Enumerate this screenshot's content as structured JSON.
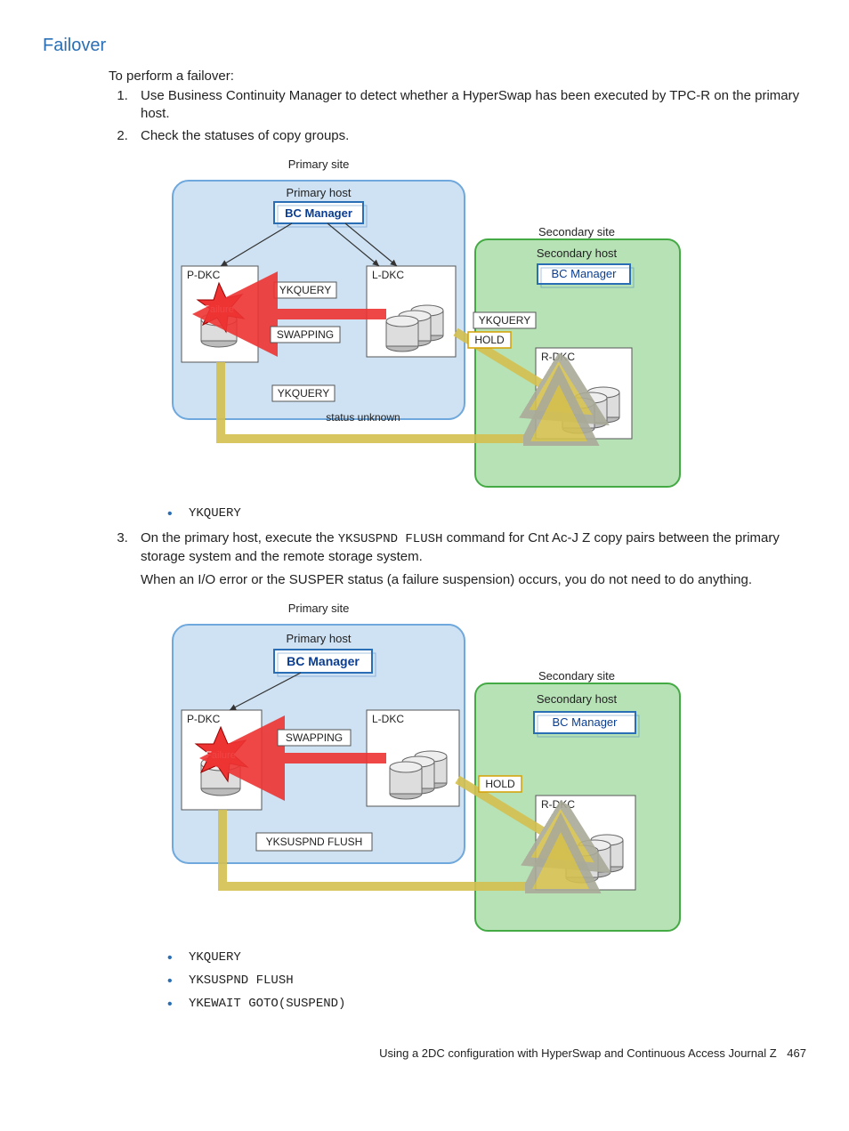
{
  "heading": "Failover",
  "intro": "To perform a failover:",
  "steps": {
    "s1": "Use Business Continuity Manager to detect whether a HyperSwap has been executed by TPC-R on the primary host.",
    "s2": "Check the statuses of copy groups.",
    "s3_a": "On the primary host, execute the ",
    "s3_code": "YKSUSPND FLUSH",
    "s3_b": " command for Cnt Ac-J Z copy pairs between the primary storage system and the remote storage system.",
    "s3_note": "When an I/O error or the SUSPER status (a failure suspension) occurs, you do not need to do anything."
  },
  "bullets1": [
    "YKQUERY"
  ],
  "bullets2": [
    "YKQUERY",
    "YKSUSPND FLUSH",
    "YKEWAIT GOTO(SUSPEND)"
  ],
  "diagram1": {
    "primary_site": "Primary site",
    "primary_host": "Primary host",
    "bc_manager": "BC Manager",
    "secondary_site": "Secondary site",
    "secondary_host": "Secondary host",
    "pdkc": "P-DKC",
    "ldkc": "L-DKC",
    "rdkc": "R-DKC",
    "failure": "Failure",
    "swapping": "SWAPPING",
    "hold": "HOLD",
    "ykquery": "YKQUERY",
    "status_unknown": "status unknown"
  },
  "diagram2": {
    "yksuspnd_flush": "YKSUSPND FLUSH"
  },
  "footer": {
    "text": "Using a 2DC configuration with HyperSwap and Continuous Access Journal Z",
    "page": "467"
  }
}
